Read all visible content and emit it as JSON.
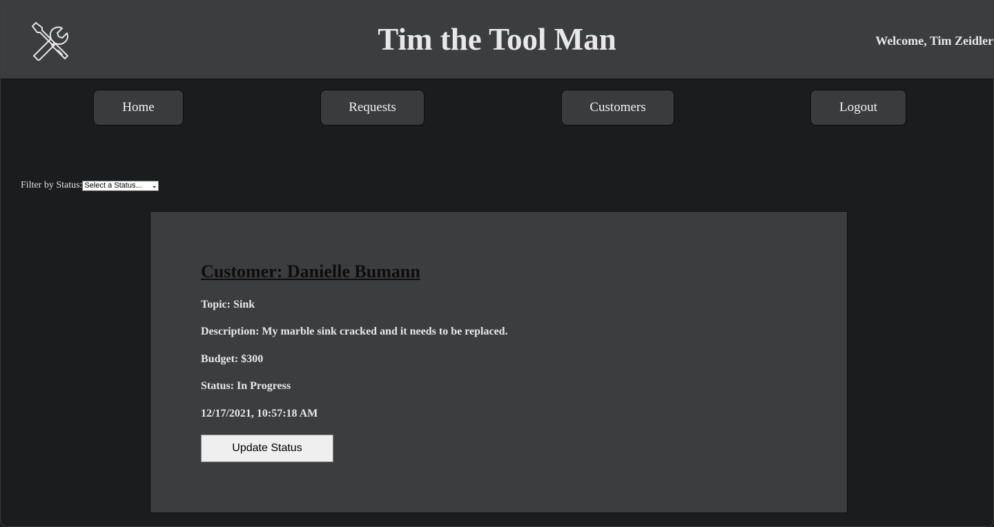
{
  "header": {
    "logo_icon": "wrench-screwdriver-icon",
    "title": "Tim the Tool Man",
    "welcome": "Welcome, Tim Zeidler"
  },
  "nav": {
    "home": "Home",
    "requests": "Requests",
    "customers": "Customers",
    "logout": "Logout"
  },
  "filter": {
    "label": "Filter by Status:",
    "selected": "Select a Status..."
  },
  "request": {
    "customer": "Customer: Danielle Bumann",
    "topic": "Topic: Sink",
    "description": "Description: My marble sink cracked and it needs to be replaced.",
    "budget": "Budget: $300",
    "status": "Status: In Progress",
    "timestamp": "12/17/2021, 10:57:18 AM",
    "update_label": "Update Status"
  },
  "colors": {
    "page_bg": "#1b1c1e",
    "panel_bg": "#3c3d3f",
    "text": "#e8e8ea"
  }
}
